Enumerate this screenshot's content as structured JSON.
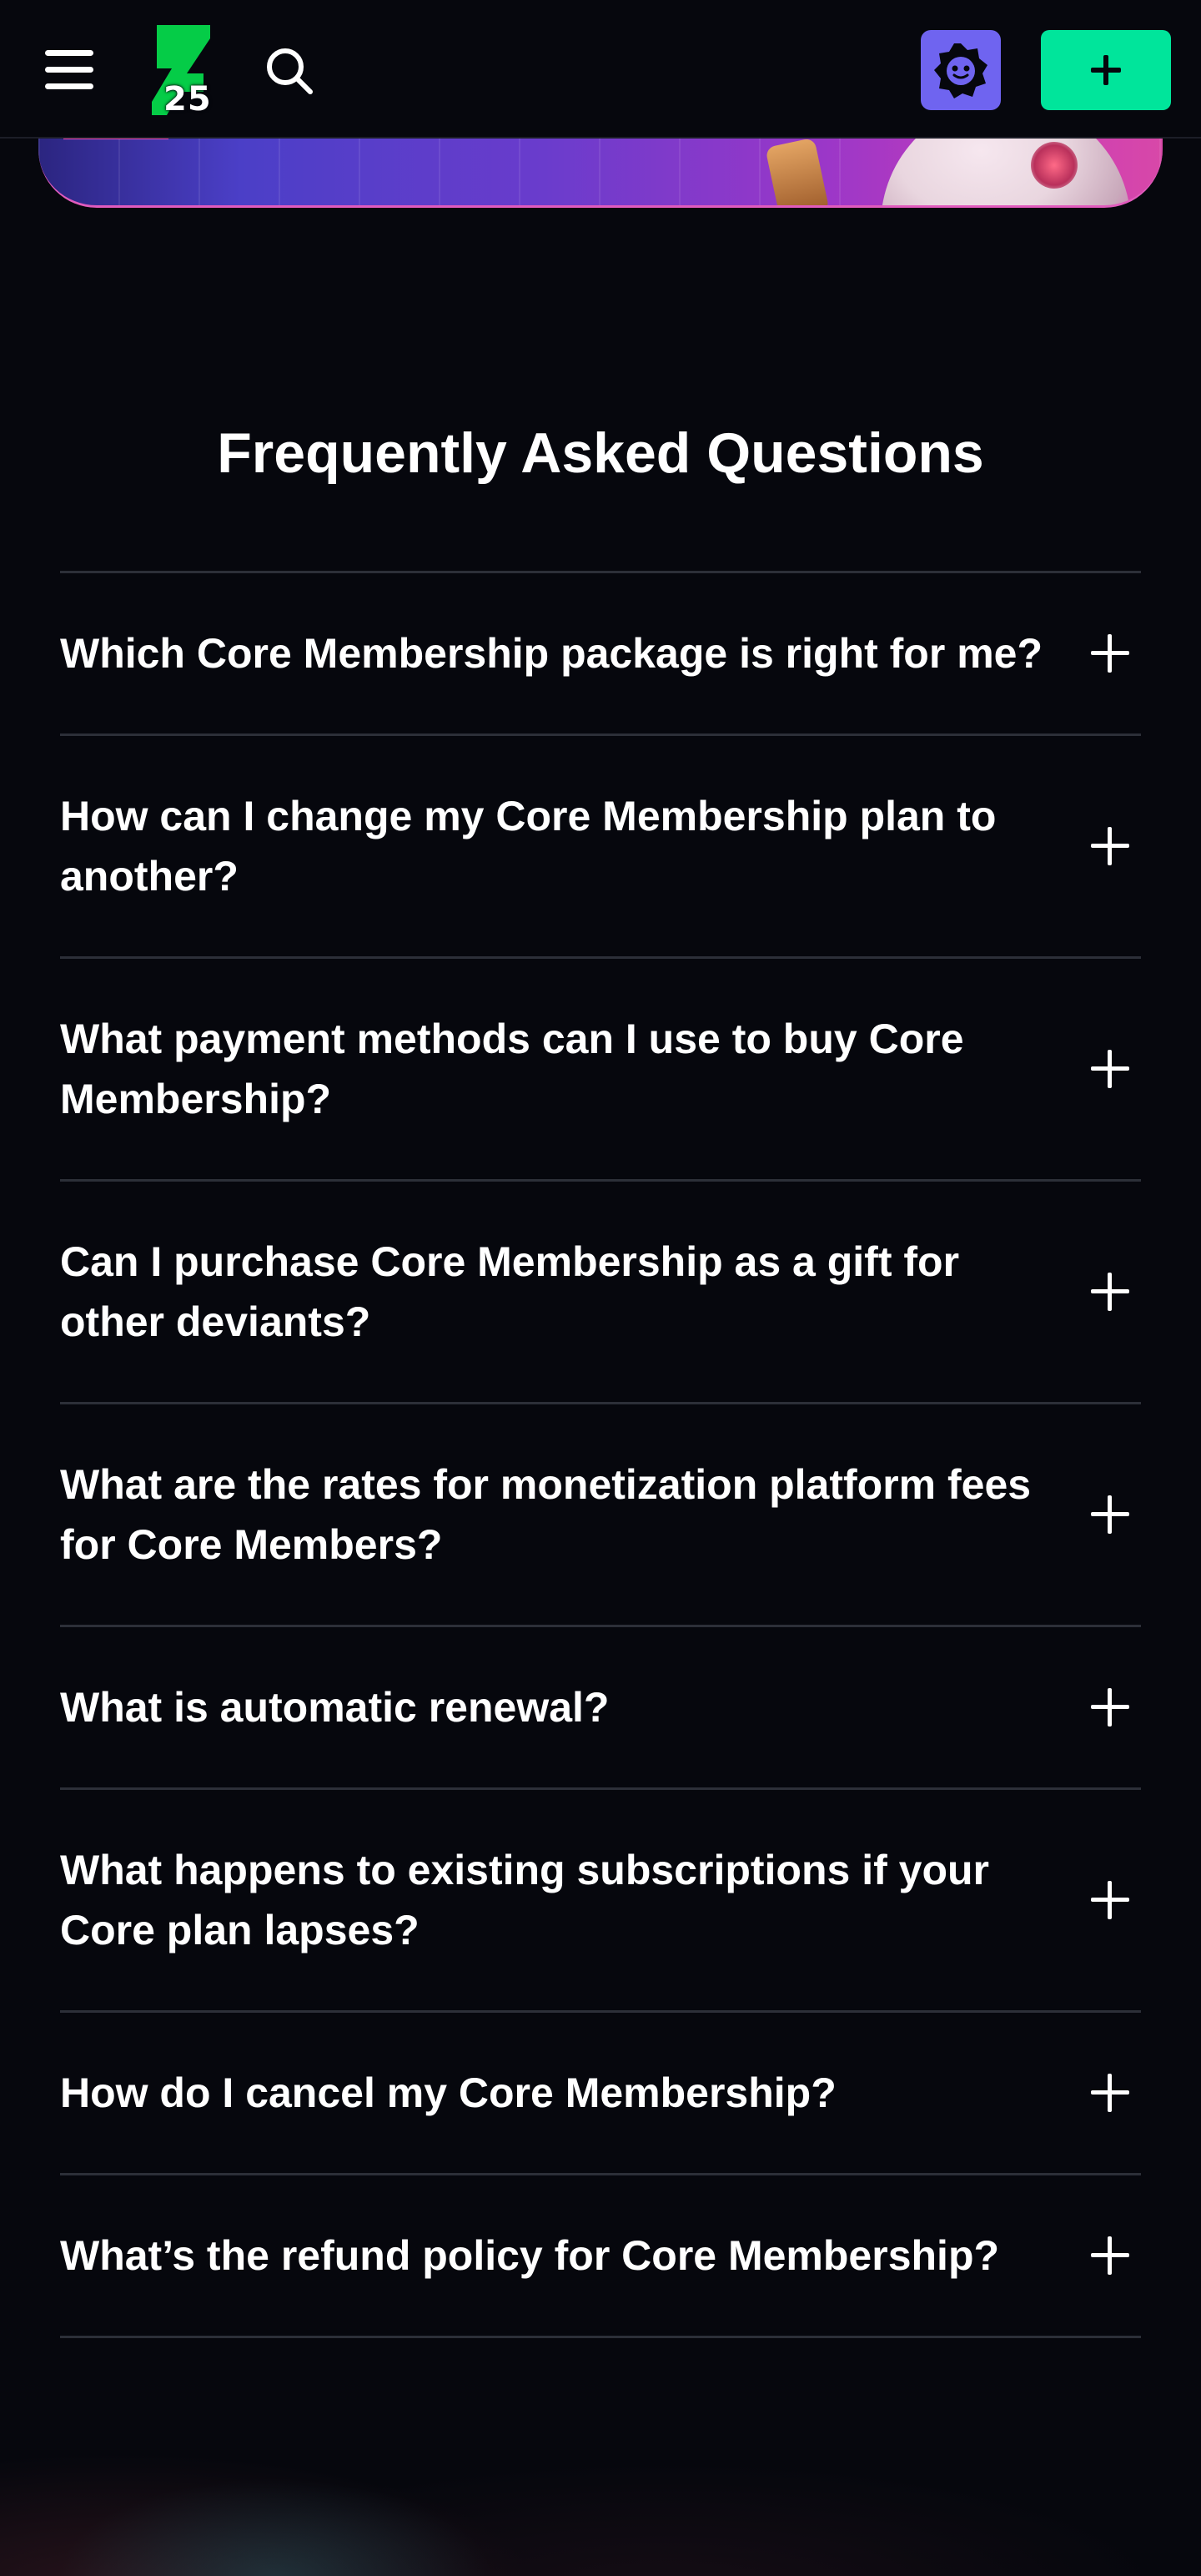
{
  "nav": {
    "menu_icon": "hamburger-menu-icon",
    "logo_badge": "25",
    "logo_color": "#05cc47",
    "search_icon": "search-icon",
    "shield_button_color": "#6f64f0",
    "add_button_color": "#00e59b"
  },
  "faq": {
    "title": "Frequently Asked Questions",
    "items": [
      {
        "question": "Which Core Membership package is right for me?"
      },
      {
        "question": "How can I change my Core Membership plan to another?"
      },
      {
        "question": "What payment methods can I use to buy Core Membership?"
      },
      {
        "question": "Can I purchase Core Membership as a gift for other deviants?"
      },
      {
        "question": "What are the rates for monetization platform fees for Core Members?"
      },
      {
        "question": "What is automatic renewal?"
      },
      {
        "question": "What happens to existing subscriptions if your Core plan lapses?"
      },
      {
        "question": "How do I cancel my Core Membership?"
      },
      {
        "question": "What’s the refund policy for Core Membership?"
      }
    ]
  },
  "theme": {
    "background": "#06070d",
    "divider": "#2c2f38",
    "text": "#ffffff"
  }
}
